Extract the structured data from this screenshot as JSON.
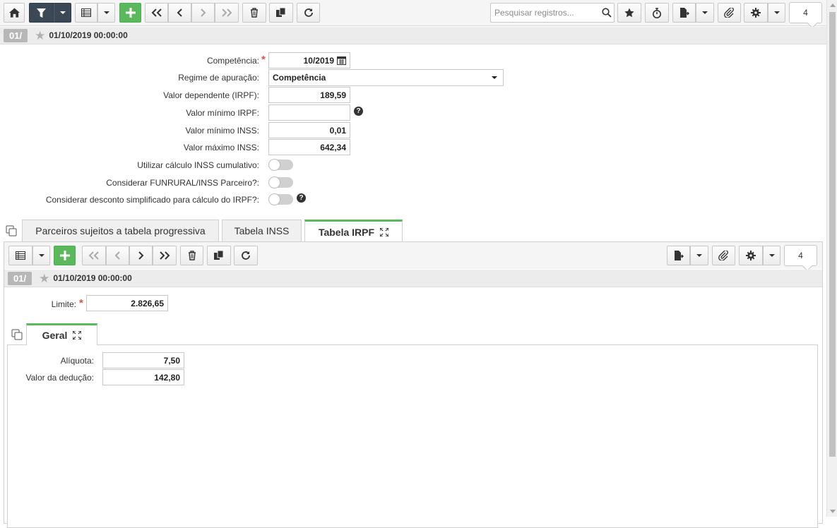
{
  "toolbar": {
    "search_placeholder": "Pesquisar registros...",
    "record_count": "4"
  },
  "record": {
    "badge": "01/",
    "date": "01/10/2019 00:00:00"
  },
  "form": {
    "competencia_label": "Competência:",
    "competencia_value": "10/2019",
    "regime_label": "Regime de apuração:",
    "regime_value": "Competência",
    "valor_dependente_label": "Valor dependente (IRPF):",
    "valor_dependente_value": "189,59",
    "valor_minimo_irpf_label": "Valor mínimo IRPF:",
    "valor_minimo_irpf_value": "",
    "valor_minimo_inss_label": "Valor mínimo INSS:",
    "valor_minimo_inss_value": "0,01",
    "valor_maximo_inss_label": "Valor máximo INSS:",
    "valor_maximo_inss_value": "642,34",
    "inss_cumulativo_label": "Utilizar cálculo INSS cumulativo:",
    "funrural_label": "Considerar FUNRURAL/INSS Parceiro?:",
    "desconto_simplificado_label": "Considerar desconto simplificado para cálculo do IRPF?:"
  },
  "tabs": [
    {
      "label": "Parceiros sujeitos a tabela progressiva"
    },
    {
      "label": "Tabela INSS"
    },
    {
      "label": "Tabela IRPF"
    }
  ],
  "subtoolbar": {
    "record_count": "4"
  },
  "subrecord": {
    "badge": "01/",
    "date": "01/10/2019 00:00:00",
    "limite_label": "Limite:",
    "limite_value": "2.826,65"
  },
  "subtabs": [
    {
      "label": "Geral"
    }
  ],
  "geral": {
    "aliquota_label": "Alíquota:",
    "aliquota_value": "7,50",
    "deducao_label": "Valor da dedução:",
    "deducao_value": "142,80"
  },
  "colors": {
    "accent_green": "#5cb85c",
    "dark_button": "#3b4957",
    "required": "#d9534f"
  }
}
